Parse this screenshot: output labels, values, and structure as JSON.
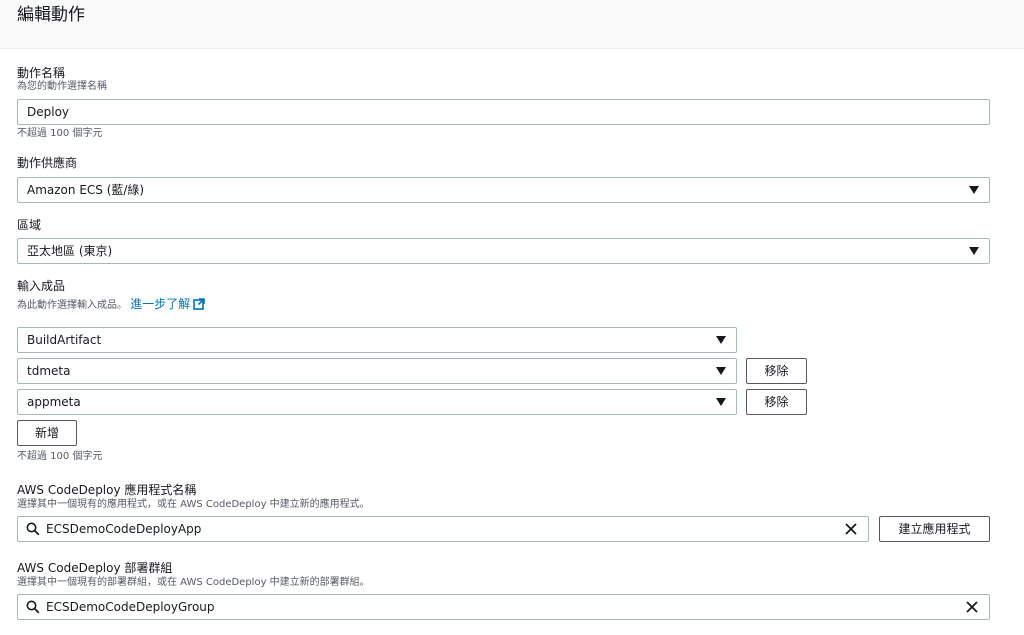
{
  "header": {
    "title": "編輯動作"
  },
  "action_name": {
    "label": "動作名稱",
    "description": "為您的動作選擇名稱",
    "value": "Deploy",
    "hint": "不超過 100 個字元"
  },
  "action_provider": {
    "label": "動作供應商",
    "value": "Amazon ECS (藍/綠)"
  },
  "region": {
    "label": "區域",
    "value": "亞太地區 (東京)"
  },
  "input_artifacts": {
    "label": "輸入成品",
    "description": "為此動作選擇輸入成品。",
    "learn_more": "進一步了解",
    "items": [
      {
        "value": "BuildArtifact"
      },
      {
        "value": "tdmeta",
        "remove_label": "移除"
      },
      {
        "value": "appmeta",
        "remove_label": "移除"
      }
    ],
    "add_label": "新增",
    "hint": "不超過 100 個字元"
  },
  "codedeploy_app": {
    "label": "AWS CodeDeploy 應用程式名稱",
    "description": "選擇其中一個現有的應用程式，或在 AWS CodeDeploy 中建立新的應用程式。",
    "value": "ECSDemoCodeDeployApp",
    "create_label": "建立應用程式"
  },
  "codedeploy_group": {
    "label": "AWS CodeDeploy 部署群組",
    "description": "選擇其中一個現有的部署群組，或在 AWS CodeDeploy 中建立新的部署群組。",
    "value": "ECSDemoCodeDeployGroup"
  },
  "icons": {
    "caret": "caret-down-icon",
    "search": "search-icon",
    "clear": "close-icon",
    "external": "external-link-icon"
  },
  "colors": {
    "link": "#0073bb",
    "border": "#aab7b8",
    "text": "#16191f",
    "muted": "#545b64"
  }
}
